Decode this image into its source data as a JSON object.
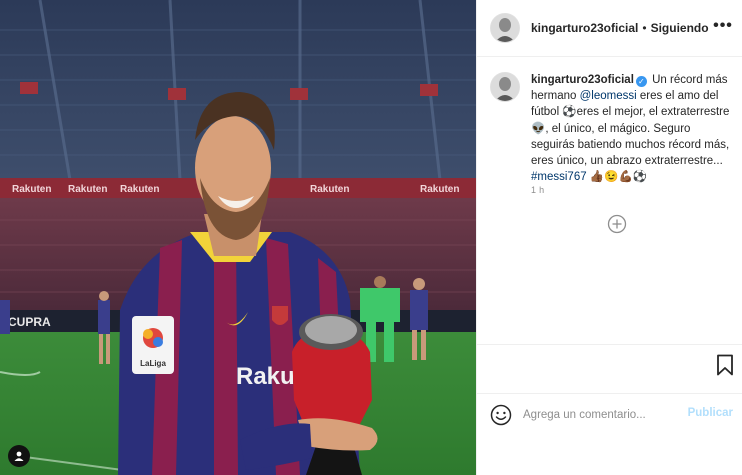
{
  "header": {
    "username": "kingarturo23oficial",
    "separator": "•",
    "follow_status": "Siguiendo",
    "more_label": "•••"
  },
  "caption": {
    "username": "kingarturo23oficial",
    "verified": true,
    "parts": {
      "p1": "Un récord más hermano ",
      "mention": "@leomessi",
      "p2": " eres el amo del fútbol ⚽eres el mejor, el extraterrestre👽, el único, el mágico. Seguro seguirás batiendo muchos récord más, eres único, un abrazo extraterrestre... ",
      "hashtag": "#messi767",
      "p3": " 👍🏾😉💪🏾⚽"
    }
  },
  "timestamp": "1 h",
  "comment_box": {
    "placeholder": "Agrega un comentario...",
    "post_label": "Publicar"
  },
  "photo": {
    "ad_board_text": "Rakuten",
    "pitch_board_text": "CUPRA",
    "shirt_sponsor": "Rakuten",
    "badge_text": "LaLiga"
  },
  "icons": {
    "more": "more-options-icon",
    "verified": "verified-badge-icon",
    "add_comment": "add-circle-icon",
    "bookmark": "bookmark-icon",
    "emoji": "emoji-smile-icon",
    "tag": "user-tag-icon"
  },
  "colors": {
    "link": "#00376b",
    "verified": "#3897f0",
    "publish_disabled": "#b2dffc",
    "timestamp": "#8e8e8e"
  }
}
